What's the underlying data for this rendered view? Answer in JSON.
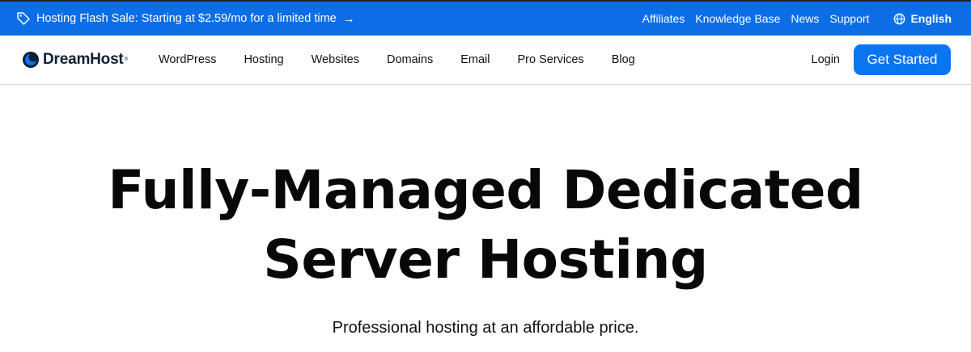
{
  "promo": {
    "icon": "tag-icon",
    "text": "Hosting Flash Sale: Starting at $2.59/mo for a limited time",
    "arrow": "→"
  },
  "utility_nav": {
    "links": [
      "Affiliates",
      "Knowledge Base",
      "News",
      "Support"
    ],
    "language": "English",
    "language_icon": "globe-icon"
  },
  "brand": {
    "name": "DreamHost",
    "trademark": "®"
  },
  "main_nav": {
    "items": [
      "WordPress",
      "Hosting",
      "Websites",
      "Domains",
      "Email",
      "Pro Services",
      "Blog"
    ],
    "login": "Login",
    "cta": "Get Started"
  },
  "hero": {
    "title_line1": "Fully-Managed Dedicated",
    "title_line2": "Server Hosting",
    "subtitle": "Professional hosting at an affordable price."
  },
  "colors": {
    "promo_bg": "#0b6ee6",
    "cta_bg": "#0b74f0",
    "logo_dark": "#0a1f33"
  }
}
